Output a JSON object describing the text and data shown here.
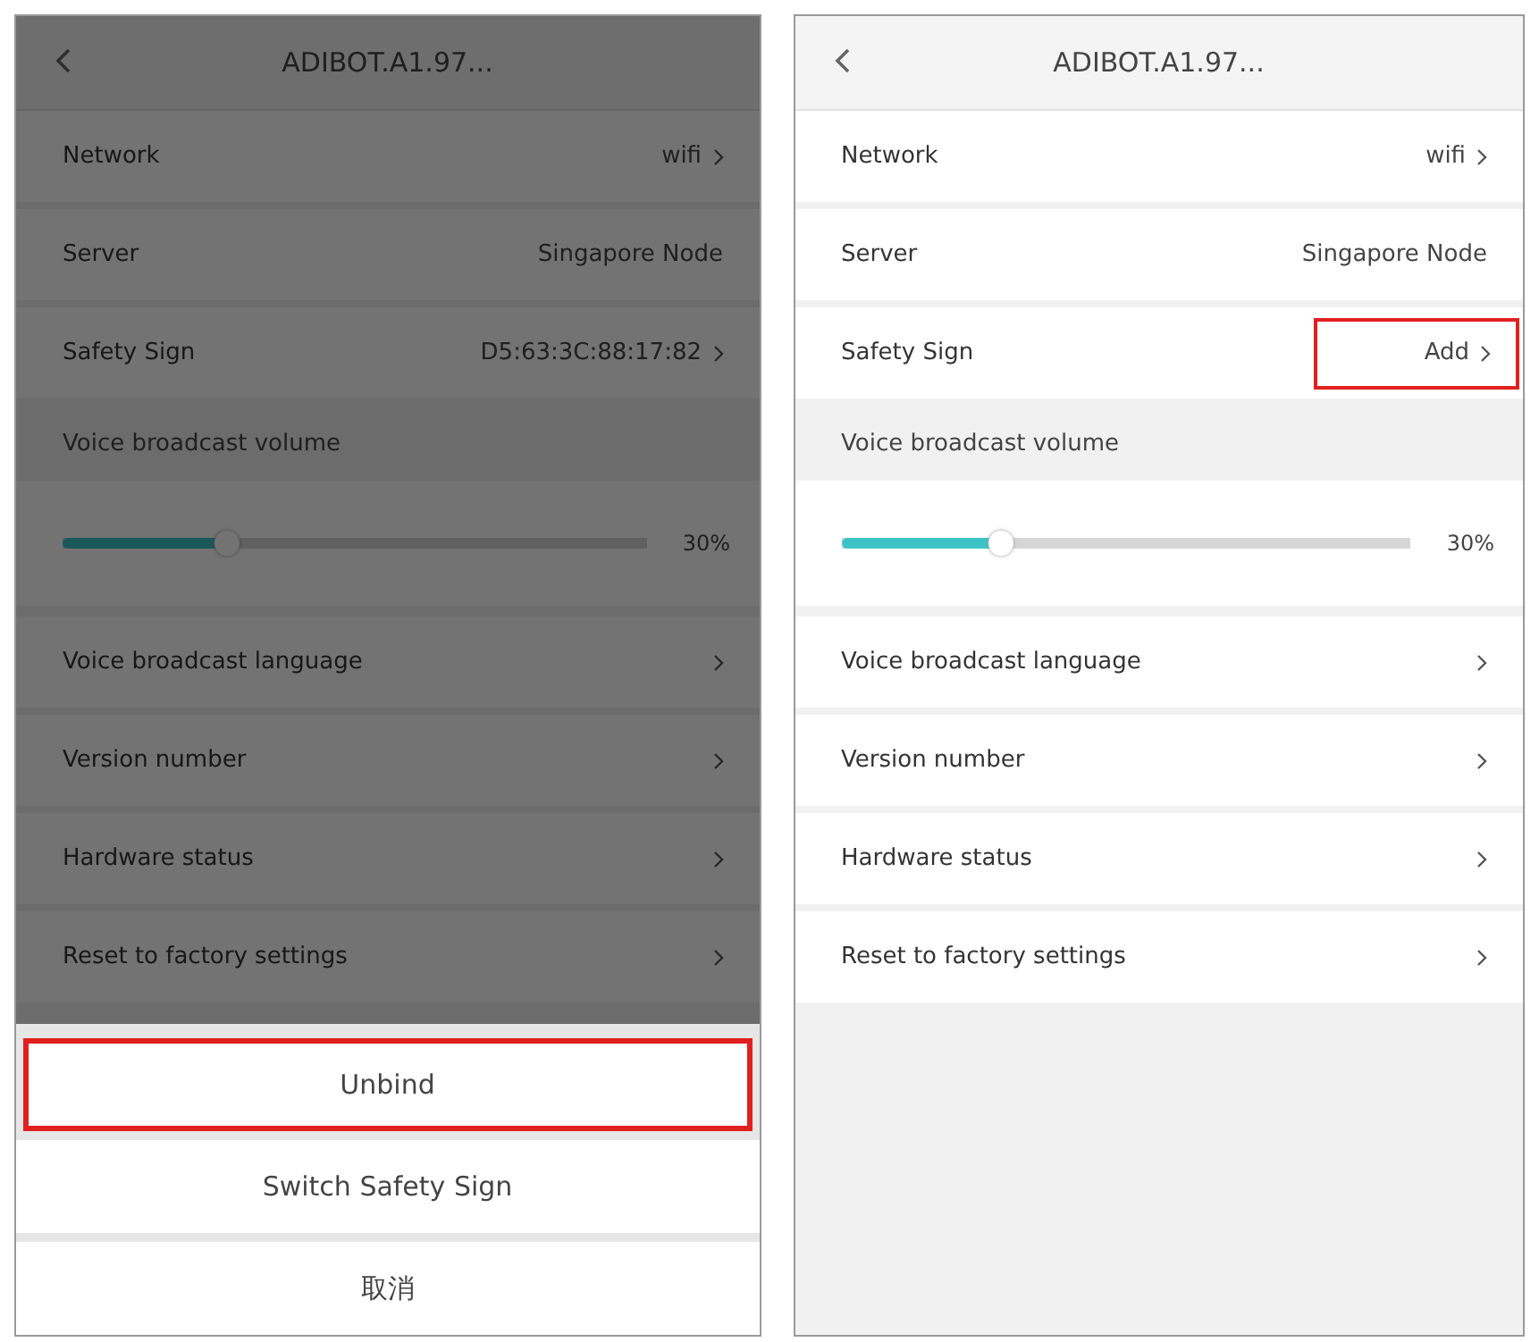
{
  "screens": [
    {
      "dimmed": true,
      "title": "ADIBOT.A1.97...",
      "rows": [
        {
          "kind": "value",
          "label": "Network",
          "value": "wifi",
          "chevron": true,
          "highlighted": false
        },
        {
          "kind": "value",
          "label": "Server",
          "value": "Singapore Node",
          "chevron": false,
          "highlighted": false
        },
        {
          "kind": "value",
          "label": "Safety Sign",
          "value": "D5:63:3C:88:17:82",
          "chevron": true,
          "highlighted": false
        },
        {
          "kind": "section",
          "label": "Voice broadcast volume"
        },
        {
          "kind": "slider",
          "level": 0.28,
          "reading": "30%"
        },
        {
          "kind": "value",
          "label": "Voice broadcast language",
          "chevron": true,
          "highlighted": false
        },
        {
          "kind": "value",
          "label": "Version number",
          "chevron": true,
          "highlighted": false
        },
        {
          "kind": "value",
          "label": "Hardware status",
          "chevron": true,
          "highlighted": false
        },
        {
          "kind": "value",
          "label": "Reset to factory settings",
          "chevron": true,
          "highlighted": false
        }
      ],
      "action_sheet": [
        {
          "label": "Unbind",
          "highlighted": true
        },
        {
          "label": "Switch Safety Sign",
          "highlighted": false
        },
        {
          "label": "取消",
          "highlighted": false
        }
      ]
    },
    {
      "dimmed": false,
      "title": "ADIBOT.A1.97...",
      "rows": [
        {
          "kind": "value",
          "label": "Network",
          "value": "wifi",
          "chevron": true,
          "highlighted": false
        },
        {
          "kind": "value",
          "label": "Server",
          "value": "Singapore Node",
          "chevron": false,
          "highlighted": false
        },
        {
          "kind": "value",
          "label": "Safety Sign",
          "value": "Add",
          "chevron": true,
          "highlighted": true
        },
        {
          "kind": "section",
          "label": "Voice broadcast volume"
        },
        {
          "kind": "slider",
          "level": 0.28,
          "reading": "30%"
        },
        {
          "kind": "value",
          "label": "Voice broadcast language",
          "chevron": true,
          "highlighted": false
        },
        {
          "kind": "value",
          "label": "Version number",
          "chevron": true,
          "highlighted": false
        },
        {
          "kind": "value",
          "label": "Hardware status",
          "chevron": true,
          "highlighted": false
        },
        {
          "kind": "value",
          "label": "Reset to factory settings",
          "chevron": true,
          "highlighted": false
        }
      ]
    }
  ]
}
